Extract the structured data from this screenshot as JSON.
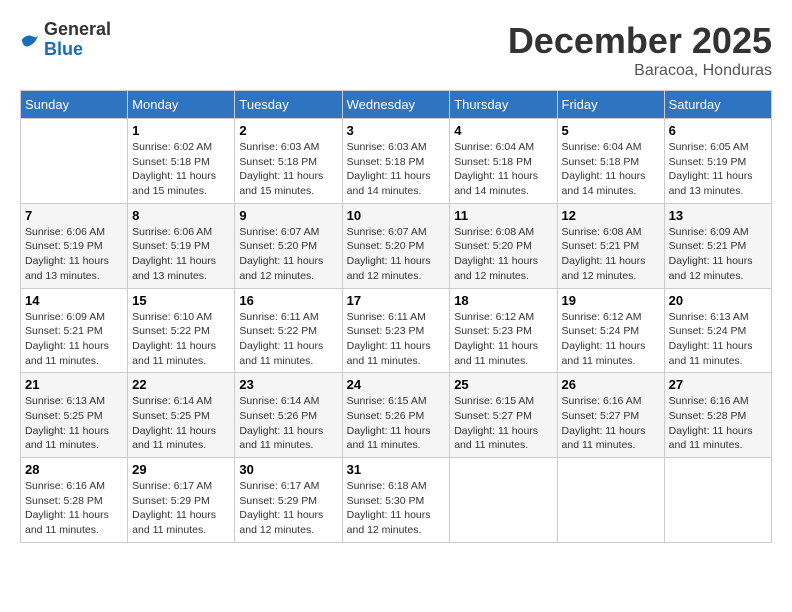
{
  "header": {
    "logo": {
      "general": "General",
      "blue": "Blue"
    },
    "title": "December 2025",
    "location": "Baracoa, Honduras"
  },
  "calendar": {
    "days_of_week": [
      "Sunday",
      "Monday",
      "Tuesday",
      "Wednesday",
      "Thursday",
      "Friday",
      "Saturday"
    ],
    "weeks": [
      [
        {
          "day": "",
          "sunrise": "",
          "sunset": "",
          "daylight": ""
        },
        {
          "day": "1",
          "sunrise": "Sunrise: 6:02 AM",
          "sunset": "Sunset: 5:18 PM",
          "daylight": "Daylight: 11 hours and 15 minutes."
        },
        {
          "day": "2",
          "sunrise": "Sunrise: 6:03 AM",
          "sunset": "Sunset: 5:18 PM",
          "daylight": "Daylight: 11 hours and 15 minutes."
        },
        {
          "day": "3",
          "sunrise": "Sunrise: 6:03 AM",
          "sunset": "Sunset: 5:18 PM",
          "daylight": "Daylight: 11 hours and 14 minutes."
        },
        {
          "day": "4",
          "sunrise": "Sunrise: 6:04 AM",
          "sunset": "Sunset: 5:18 PM",
          "daylight": "Daylight: 11 hours and 14 minutes."
        },
        {
          "day": "5",
          "sunrise": "Sunrise: 6:04 AM",
          "sunset": "Sunset: 5:18 PM",
          "daylight": "Daylight: 11 hours and 14 minutes."
        },
        {
          "day": "6",
          "sunrise": "Sunrise: 6:05 AM",
          "sunset": "Sunset: 5:19 PM",
          "daylight": "Daylight: 11 hours and 13 minutes."
        }
      ],
      [
        {
          "day": "7",
          "sunrise": "Sunrise: 6:06 AM",
          "sunset": "Sunset: 5:19 PM",
          "daylight": "Daylight: 11 hours and 13 minutes."
        },
        {
          "day": "8",
          "sunrise": "Sunrise: 6:06 AM",
          "sunset": "Sunset: 5:19 PM",
          "daylight": "Daylight: 11 hours and 13 minutes."
        },
        {
          "day": "9",
          "sunrise": "Sunrise: 6:07 AM",
          "sunset": "Sunset: 5:20 PM",
          "daylight": "Daylight: 11 hours and 12 minutes."
        },
        {
          "day": "10",
          "sunrise": "Sunrise: 6:07 AM",
          "sunset": "Sunset: 5:20 PM",
          "daylight": "Daylight: 11 hours and 12 minutes."
        },
        {
          "day": "11",
          "sunrise": "Sunrise: 6:08 AM",
          "sunset": "Sunset: 5:20 PM",
          "daylight": "Daylight: 11 hours and 12 minutes."
        },
        {
          "day": "12",
          "sunrise": "Sunrise: 6:08 AM",
          "sunset": "Sunset: 5:21 PM",
          "daylight": "Daylight: 11 hours and 12 minutes."
        },
        {
          "day": "13",
          "sunrise": "Sunrise: 6:09 AM",
          "sunset": "Sunset: 5:21 PM",
          "daylight": "Daylight: 11 hours and 12 minutes."
        }
      ],
      [
        {
          "day": "14",
          "sunrise": "Sunrise: 6:09 AM",
          "sunset": "Sunset: 5:21 PM",
          "daylight": "Daylight: 11 hours and 11 minutes."
        },
        {
          "day": "15",
          "sunrise": "Sunrise: 6:10 AM",
          "sunset": "Sunset: 5:22 PM",
          "daylight": "Daylight: 11 hours and 11 minutes."
        },
        {
          "day": "16",
          "sunrise": "Sunrise: 6:11 AM",
          "sunset": "Sunset: 5:22 PM",
          "daylight": "Daylight: 11 hours and 11 minutes."
        },
        {
          "day": "17",
          "sunrise": "Sunrise: 6:11 AM",
          "sunset": "Sunset: 5:23 PM",
          "daylight": "Daylight: 11 hours and 11 minutes."
        },
        {
          "day": "18",
          "sunrise": "Sunrise: 6:12 AM",
          "sunset": "Sunset: 5:23 PM",
          "daylight": "Daylight: 11 hours and 11 minutes."
        },
        {
          "day": "19",
          "sunrise": "Sunrise: 6:12 AM",
          "sunset": "Sunset: 5:24 PM",
          "daylight": "Daylight: 11 hours and 11 minutes."
        },
        {
          "day": "20",
          "sunrise": "Sunrise: 6:13 AM",
          "sunset": "Sunset: 5:24 PM",
          "daylight": "Daylight: 11 hours and 11 minutes."
        }
      ],
      [
        {
          "day": "21",
          "sunrise": "Sunrise: 6:13 AM",
          "sunset": "Sunset: 5:25 PM",
          "daylight": "Daylight: 11 hours and 11 minutes."
        },
        {
          "day": "22",
          "sunrise": "Sunrise: 6:14 AM",
          "sunset": "Sunset: 5:25 PM",
          "daylight": "Daylight: 11 hours and 11 minutes."
        },
        {
          "day": "23",
          "sunrise": "Sunrise: 6:14 AM",
          "sunset": "Sunset: 5:26 PM",
          "daylight": "Daylight: 11 hours and 11 minutes."
        },
        {
          "day": "24",
          "sunrise": "Sunrise: 6:15 AM",
          "sunset": "Sunset: 5:26 PM",
          "daylight": "Daylight: 11 hours and 11 minutes."
        },
        {
          "day": "25",
          "sunrise": "Sunrise: 6:15 AM",
          "sunset": "Sunset: 5:27 PM",
          "daylight": "Daylight: 11 hours and 11 minutes."
        },
        {
          "day": "26",
          "sunrise": "Sunrise: 6:16 AM",
          "sunset": "Sunset: 5:27 PM",
          "daylight": "Daylight: 11 hours and 11 minutes."
        },
        {
          "day": "27",
          "sunrise": "Sunrise: 6:16 AM",
          "sunset": "Sunset: 5:28 PM",
          "daylight": "Daylight: 11 hours and 11 minutes."
        }
      ],
      [
        {
          "day": "28",
          "sunrise": "Sunrise: 6:16 AM",
          "sunset": "Sunset: 5:28 PM",
          "daylight": "Daylight: 11 hours and 11 minutes."
        },
        {
          "day": "29",
          "sunrise": "Sunrise: 6:17 AM",
          "sunset": "Sunset: 5:29 PM",
          "daylight": "Daylight: 11 hours and 11 minutes."
        },
        {
          "day": "30",
          "sunrise": "Sunrise: 6:17 AM",
          "sunset": "Sunset: 5:29 PM",
          "daylight": "Daylight: 11 hours and 12 minutes."
        },
        {
          "day": "31",
          "sunrise": "Sunrise: 6:18 AM",
          "sunset": "Sunset: 5:30 PM",
          "daylight": "Daylight: 11 hours and 12 minutes."
        },
        {
          "day": "",
          "sunrise": "",
          "sunset": "",
          "daylight": ""
        },
        {
          "day": "",
          "sunrise": "",
          "sunset": "",
          "daylight": ""
        },
        {
          "day": "",
          "sunrise": "",
          "sunset": "",
          "daylight": ""
        }
      ]
    ]
  }
}
